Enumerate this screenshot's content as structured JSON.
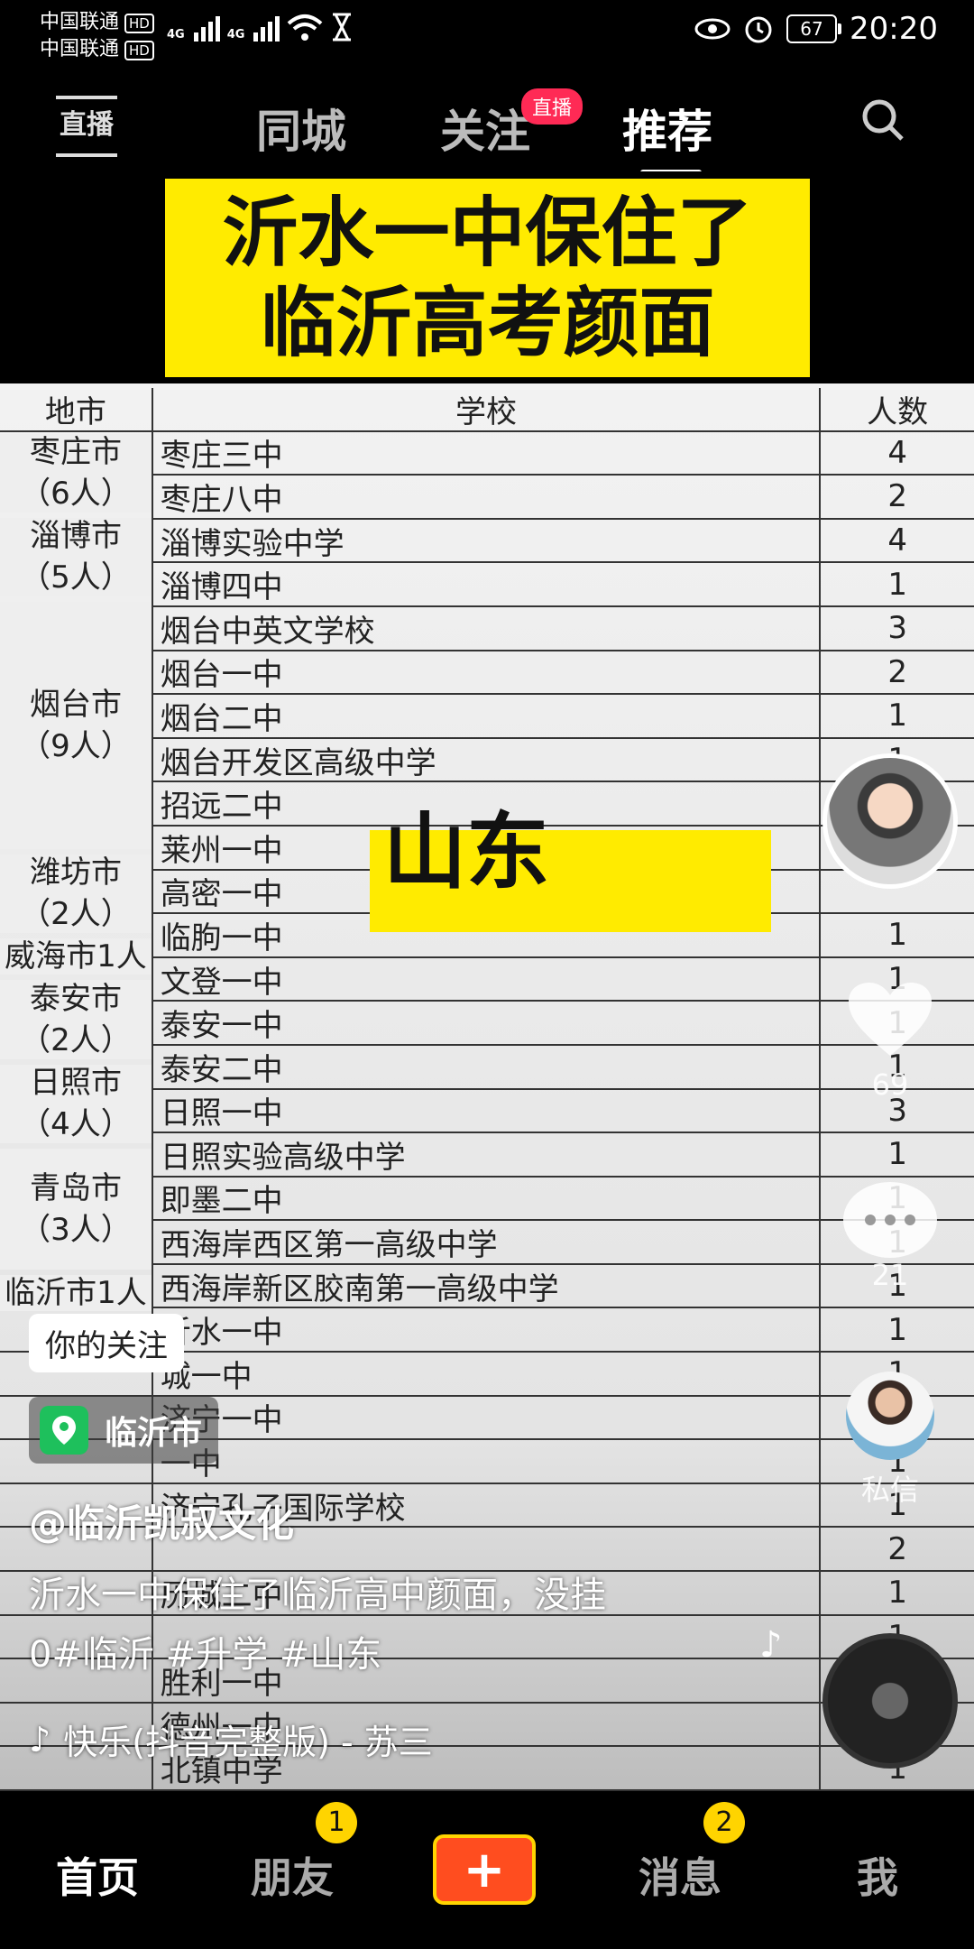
{
  "status_bar": {
    "carrier1": "中国联通",
    "carrier2": "中国联通",
    "hd": "HD",
    "net1": "4G",
    "net2": "4G",
    "battery": "67",
    "time": "20:20"
  },
  "top_nav": {
    "live_icon_label": "直播",
    "tabs": [
      "同城",
      "关注",
      "推荐"
    ],
    "live_badge": "直播"
  },
  "video": {
    "title_line1": "沂水一中保住了",
    "title_line2": "临沂高考颜面",
    "overlay_tag": "山东",
    "table": {
      "headers": [
        "地市",
        "学校",
        "人数"
      ],
      "cities": [
        {
          "name": "枣庄市",
          "count": "（6人）"
        },
        {
          "name": "淄博市",
          "count": "（5人）"
        },
        {
          "name": "烟台市",
          "count": "（9人）"
        },
        {
          "name": "潍坊市",
          "count": "（2人）"
        },
        {
          "name": "威海市1人",
          "count": ""
        },
        {
          "name": "泰安市",
          "count": "（2人）"
        },
        {
          "name": "日照市",
          "count": "（4人）"
        },
        {
          "name": "青岛市",
          "count": "（3人）"
        },
        {
          "name": "临沂市1人",
          "count": ""
        }
      ],
      "rows": [
        {
          "school": "枣庄三中",
          "n": "4"
        },
        {
          "school": "枣庄八中",
          "n": "2"
        },
        {
          "school": "淄博实验中学",
          "n": "4"
        },
        {
          "school": "淄博四中",
          "n": "1"
        },
        {
          "school": "烟台中英文学校",
          "n": "3"
        },
        {
          "school": "烟台一中",
          "n": "2"
        },
        {
          "school": "烟台二中",
          "n": "1"
        },
        {
          "school": "烟台开发区高级中学",
          "n": "1"
        },
        {
          "school": "招远二中",
          "n": ""
        },
        {
          "school": "莱州一中",
          "n": ""
        },
        {
          "school": "高密一中",
          "n": ""
        },
        {
          "school": "临朐一中",
          "n": "1"
        },
        {
          "school": "文登一中",
          "n": "1"
        },
        {
          "school": "泰安一中",
          "n": "1"
        },
        {
          "school": "泰安二中",
          "n": "1"
        },
        {
          "school": "日照一中",
          "n": "3"
        },
        {
          "school": "日照实验高级中学",
          "n": "1"
        },
        {
          "school": "即墨二中",
          "n": "1"
        },
        {
          "school": "西海岸西区第一高级中学",
          "n": "1"
        },
        {
          "school": "西海岸新区胶南第一高级中学",
          "n": "1"
        },
        {
          "school": "沂水一中",
          "n": "1"
        },
        {
          "school": "城一中",
          "n": "1"
        },
        {
          "school": "济宁一中",
          "n": "1"
        },
        {
          "school": "一中",
          "n": "1"
        },
        {
          "school": "济宁孔子国际学校",
          "n": "1"
        },
        {
          "school": "",
          "n": "2"
        },
        {
          "school": "历城二中",
          "n": "1"
        },
        {
          "school": "",
          "n": "1"
        },
        {
          "school": "胜利一中",
          "n": ""
        },
        {
          "school": "德州一中",
          "n": ""
        },
        {
          "school": "北镇中学",
          "n": "1"
        }
      ]
    }
  },
  "overlay": {
    "follow_tag": "你的关注",
    "location": "临沂市",
    "author": "@临沂凯叔文化",
    "caption_line1": "沂水一中保住了临沂高中颜面，没挂",
    "caption_line2": "0#临沂 #升学 #山东",
    "music": "快乐(抖音完整版) - 苏三"
  },
  "right_rail": {
    "likes": "69",
    "comments": "21",
    "dm_label": "私信",
    "avatar_text": "临沂凯叔"
  },
  "bottom_nav": {
    "home": "首页",
    "friends": "朋友",
    "friends_badge": "1",
    "create": "+",
    "messages": "消息",
    "messages_badge": "2",
    "me": "我"
  }
}
